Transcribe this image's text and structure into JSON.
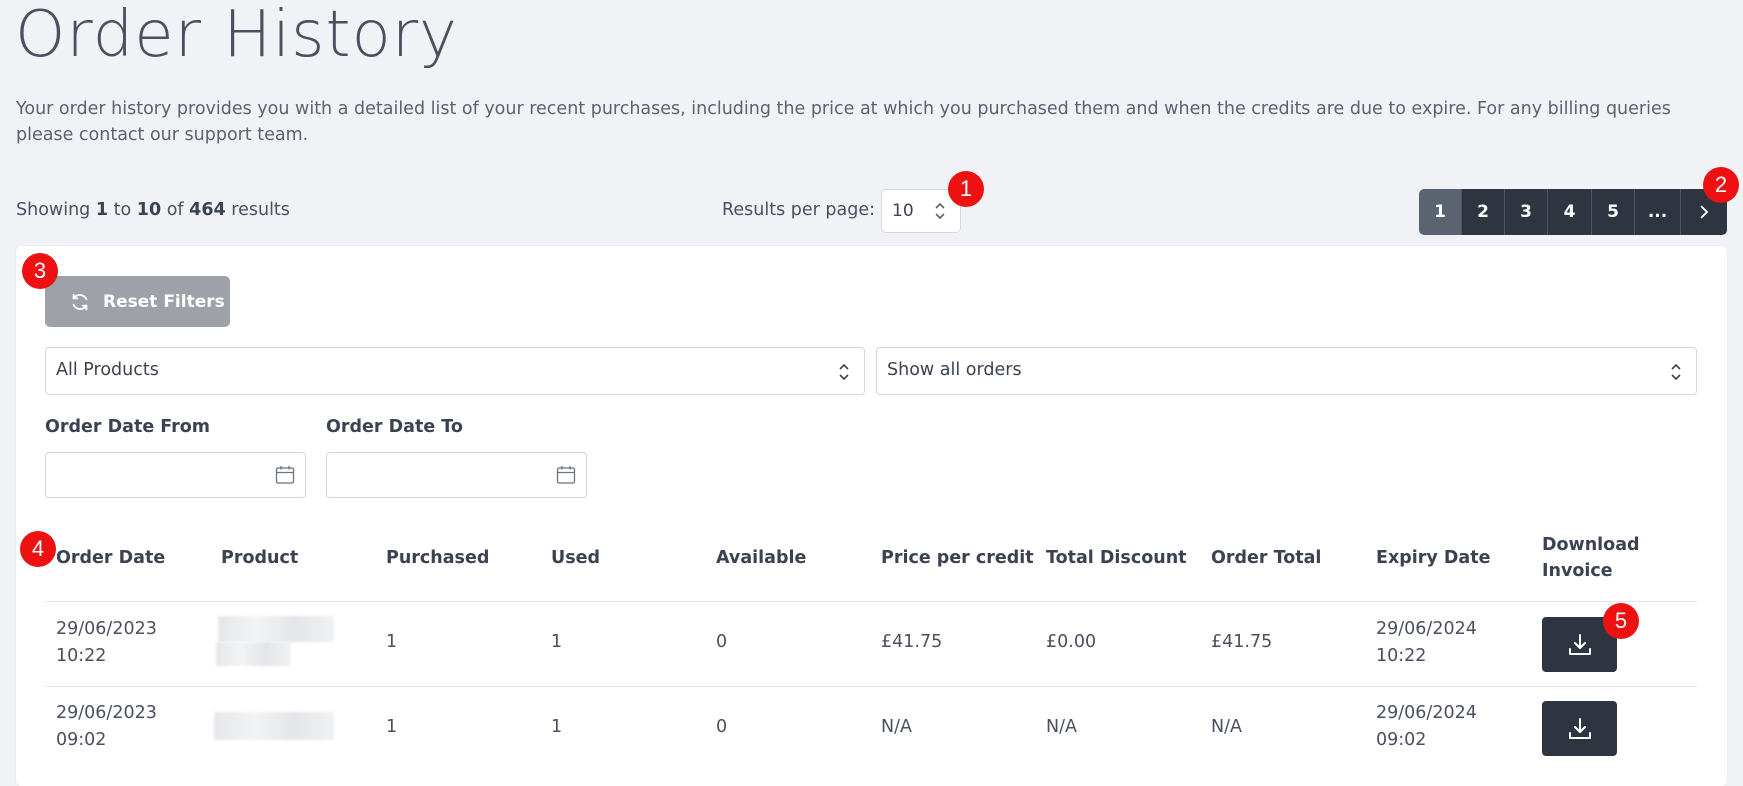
{
  "page": {
    "title": "Order History",
    "intro": "Your order history provides you with a detailed list of your recent purchases, including the price at which you purchased them and when the credits are due to expire. For any billing queries please contact our support team."
  },
  "results": {
    "showing_prefix": "Showing",
    "from": "1",
    "to_word": "to",
    "to": "10",
    "of_word": "of",
    "total": "464",
    "suffix": "results",
    "per_page_label": "Results per page:",
    "per_page_value": "10"
  },
  "pagination": {
    "pages": [
      "1",
      "2",
      "3",
      "4",
      "5"
    ],
    "active": "1",
    "ellipsis": "...",
    "next_icon": "chevron-right-icon"
  },
  "filters": {
    "reset_label": "Reset Filters",
    "reset_icon": "refresh-icon",
    "product_select": "All Products",
    "orders_select": "Show all orders",
    "date_from_label": "Order Date From",
    "date_to_label": "Order Date To",
    "date_from_value": "",
    "date_to_value": ""
  },
  "table": {
    "headers": {
      "order_date": "Order Date",
      "product": "Product",
      "purchased": "Purchased",
      "used": "Used",
      "available": "Available",
      "price_per_credit": "Price per credit",
      "total_discount": "Total Discount",
      "order_total": "Order Total",
      "expiry_date": "Expiry Date",
      "download_line1": "Download",
      "download_line2": "Invoice"
    },
    "rows": [
      {
        "order_date": "29/06/2023",
        "order_time": "10:22",
        "purchased": "1",
        "used": "1",
        "available": "0",
        "price_per_credit": "£41.75",
        "total_discount": "£0.00",
        "order_total": "£41.75",
        "expiry_date": "29/06/2024",
        "expiry_time": "10:22"
      },
      {
        "order_date": "29/06/2023",
        "order_time": "09:02",
        "purchased": "1",
        "used": "1",
        "available": "0",
        "price_per_credit": "N/A",
        "total_discount": "N/A",
        "order_total": "N/A",
        "expiry_date": "29/06/2024",
        "expiry_time": "09:02"
      }
    ]
  },
  "markers": [
    "1",
    "2",
    "3",
    "4",
    "5"
  ],
  "colors": {
    "background": "#f1f2f5",
    "dark_button": "#2e3440",
    "reset_button": "#9ea2a8",
    "marker": "#ee1111"
  }
}
